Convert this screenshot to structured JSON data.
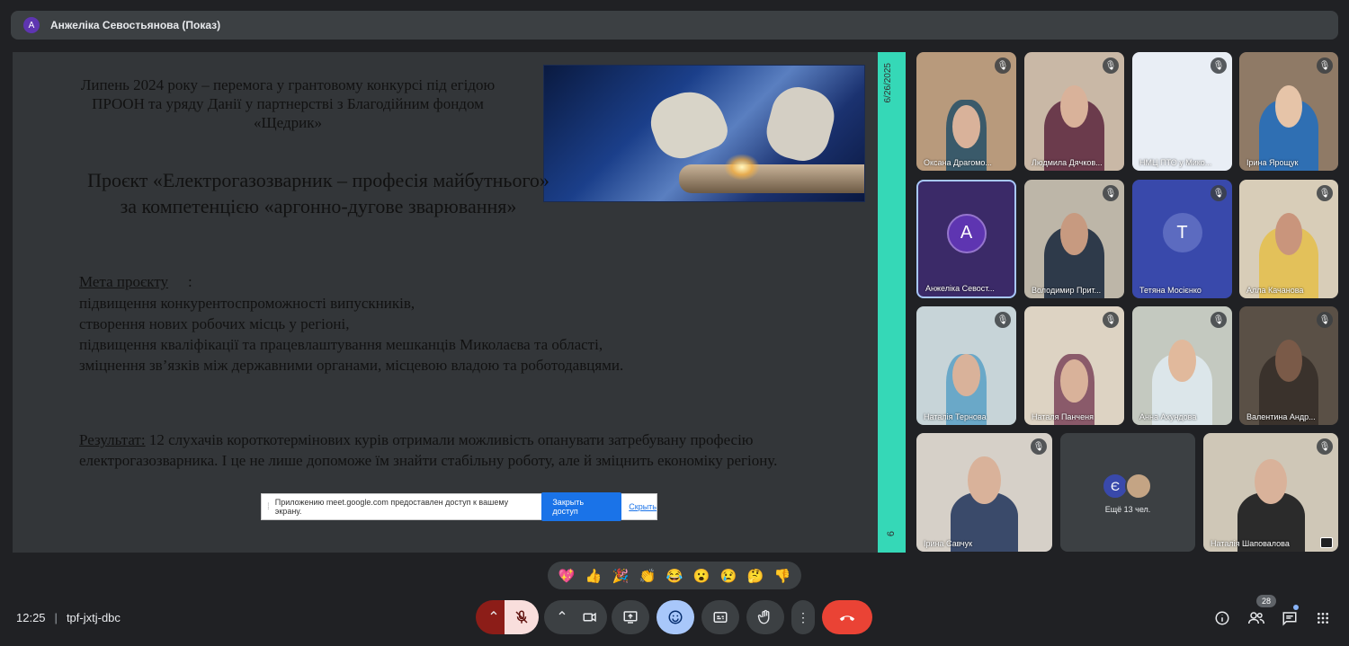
{
  "presenter": {
    "initial": "А",
    "label": "Анжеліка Севостьянова (Показ)"
  },
  "slide": {
    "heading": "Липень 2024 року – перемога у грантовому конкурсі під егідою ПРООН та уряду Данії у партнерстві з Благодійним фондом «Щедрик»",
    "title": "Проєкт «Електрогазозварник – професія майбутнього» за компетенцією «аргонно-дугове зварювання»",
    "goal_label": "Мета проєкту",
    "goal_colon": ":",
    "goal_lines": [
      "підвищення конкурентоспроможності випускників,",
      "створення нових робочих місць у регіоні,",
      "підвищення кваліфікації та працевлаштування  мешканців Миколаєва та області,",
      "зміцнення зв’язків між державними органами, місцевою владою та роботодавцями."
    ],
    "result_label": "Результат:",
    "result_text": " 12 слухачів короткотермінових курів отримали можливість опанувати затребувану професію електрогазозварника. І це не лише допоможе їм знайти стабільну роботу, але й зміцнить економіку регіону.",
    "side_date": "6/26/2025",
    "side_page": "6"
  },
  "share_notice": {
    "text": "Приложению meet.google.com предоставлен доступ к вашему экрану.",
    "stop_label": "Закрыть доступ",
    "hide_label": "Скрыть"
  },
  "participants": [
    {
      "name": "Оксана Драгомо...",
      "muted": true
    },
    {
      "name": "Людмила Дячков...",
      "muted": true
    },
    {
      "name": "НМЦ ПТО у Мико...",
      "muted": true
    },
    {
      "name": "Ірина Ярощук",
      "muted": true
    },
    {
      "name": "Анжеліка Севост...",
      "initial": "А",
      "muted": false
    },
    {
      "name": "Володимир Прит...",
      "muted": true
    },
    {
      "name": "Тетяна Мосієнко",
      "initial": "Т",
      "muted": true
    },
    {
      "name": "Алла Качанова",
      "muted": true
    },
    {
      "name": "Наталія Тернова",
      "muted": true
    },
    {
      "name": "Наталя Панченя",
      "muted": true
    },
    {
      "name": "Анна Ахундова",
      "muted": true
    },
    {
      "name": "Валентина Андр...",
      "muted": true
    },
    {
      "name": "Ірина Савчук",
      "muted": true
    },
    {
      "name": "Наталія Шаповалова",
      "muted": true
    }
  ],
  "more": {
    "initial": "Є",
    "label": "Ещё 13 чел."
  },
  "reactions": [
    "💖",
    "👍",
    "🎉",
    "👏",
    "😂",
    "😮",
    "😢",
    "🤔",
    "👎"
  ],
  "meeting": {
    "time": "12:25",
    "separator": "|",
    "code": "tpf-jxtj-dbc"
  },
  "people_count": "28",
  "colors": {
    "accent": "#a8c7fa",
    "end_call": "#ea4335",
    "slide_side": "#35d8b7"
  }
}
